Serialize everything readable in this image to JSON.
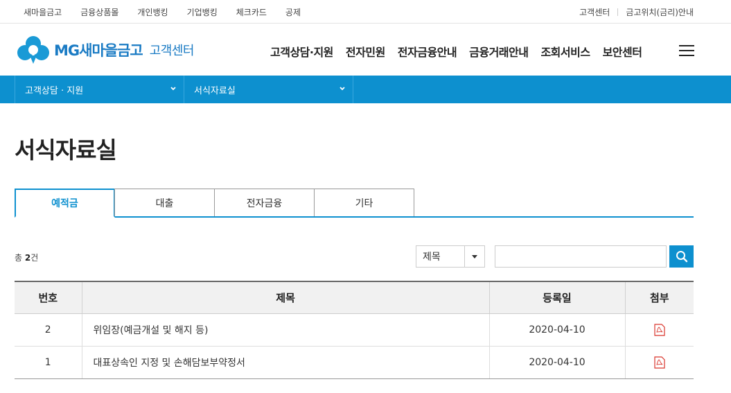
{
  "util": {
    "left_links": [
      "새마을금고",
      "금융상품몰",
      "개인뱅킹",
      "기업뱅킹",
      "체크카드",
      "공제"
    ],
    "right_links": [
      "고객센터",
      "금고위치(금리)안내"
    ]
  },
  "header": {
    "brand": "MG새마을금고",
    "sub": "고객센터",
    "nav": [
      "고객상담·지원",
      "전자민원",
      "전자금융안내",
      "금융거래안내",
      "조회서비스",
      "보안센터"
    ],
    "brand_color": "#1a7bc4"
  },
  "location": {
    "depth1": "고객상담 · 지원",
    "depth2": "서식자료실"
  },
  "page": {
    "title": "서식자료실",
    "tabs": [
      "예적금",
      "대출",
      "전자금융",
      "기타"
    ],
    "active_tab": "예적금",
    "count_prefix": "총",
    "count_value": "2",
    "count_suffix": "건"
  },
  "search": {
    "select_value": "제목",
    "input_value": ""
  },
  "table": {
    "headers": [
      "번호",
      "제목",
      "등록일",
      "첨부"
    ],
    "rows": [
      {
        "no": "2",
        "title": "위임장(예금개설 및 해지 등)",
        "date": "2020-04-10",
        "attach": "pdf-icon"
      },
      {
        "no": "1",
        "title": "대표상속인 지정 및 손해담보부약정서",
        "date": "2020-04-10",
        "attach": "pdf-icon"
      }
    ]
  },
  "colors": {
    "accent": "#0d90cf",
    "pdf": "#d9342b"
  }
}
